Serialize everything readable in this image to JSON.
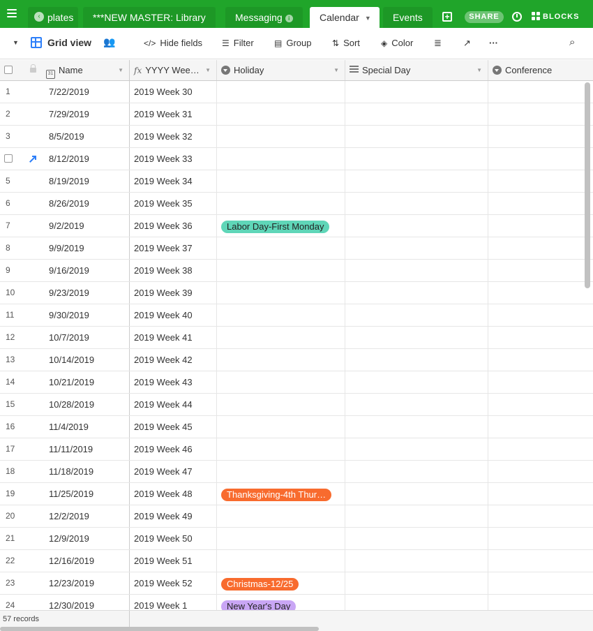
{
  "tabs": [
    {
      "label": "plates"
    },
    {
      "label": "***NEW MASTER: Library"
    },
    {
      "label": "Messaging"
    },
    {
      "label": "Calendar"
    },
    {
      "label": "Events"
    }
  ],
  "share_label": "SHARE",
  "blocks_label": "BLOCKS",
  "toolbar": {
    "view_name": "Grid view",
    "hide_fields": "Hide fields",
    "filter": "Filter",
    "group": "Group",
    "sort": "Sort",
    "color": "Color"
  },
  "columns": {
    "name": "Name",
    "week": "YYYY Wee…",
    "holiday": "Holiday",
    "special_day": "Special Day",
    "conference": "Conference"
  },
  "rows": [
    {
      "num": "1",
      "name": "7/22/2019",
      "week": "2019 Week 30",
      "holiday": ""
    },
    {
      "num": "2",
      "name": "7/29/2019",
      "week": "2019 Week 31",
      "holiday": ""
    },
    {
      "num": "3",
      "name": "8/5/2019",
      "week": "2019 Week 32",
      "holiday": ""
    },
    {
      "num": "",
      "name": "8/12/2019",
      "week": "2019 Week 33",
      "holiday": ""
    },
    {
      "num": "5",
      "name": "8/19/2019",
      "week": "2019 Week 34",
      "holiday": ""
    },
    {
      "num": "6",
      "name": "8/26/2019",
      "week": "2019 Week 35",
      "holiday": ""
    },
    {
      "num": "7",
      "name": "9/2/2019",
      "week": "2019 Week 36",
      "holiday": "Labor Day-First Monday",
      "holiday_color": "teal"
    },
    {
      "num": "8",
      "name": "9/9/2019",
      "week": "2019 Week 37",
      "holiday": ""
    },
    {
      "num": "9",
      "name": "9/16/2019",
      "week": "2019 Week 38",
      "holiday": ""
    },
    {
      "num": "10",
      "name": "9/23/2019",
      "week": "2019 Week 39",
      "holiday": ""
    },
    {
      "num": "11",
      "name": "9/30/2019",
      "week": "2019 Week 40",
      "holiday": ""
    },
    {
      "num": "12",
      "name": "10/7/2019",
      "week": "2019 Week 41",
      "holiday": ""
    },
    {
      "num": "13",
      "name": "10/14/2019",
      "week": "2019 Week 42",
      "holiday": ""
    },
    {
      "num": "14",
      "name": "10/21/2019",
      "week": "2019 Week 43",
      "holiday": ""
    },
    {
      "num": "15",
      "name": "10/28/2019",
      "week": "2019 Week 44",
      "holiday": ""
    },
    {
      "num": "16",
      "name": "11/4/2019",
      "week": "2019 Week 45",
      "holiday": ""
    },
    {
      "num": "17",
      "name": "11/11/2019",
      "week": "2019 Week 46",
      "holiday": ""
    },
    {
      "num": "18",
      "name": "11/18/2019",
      "week": "2019 Week 47",
      "holiday": ""
    },
    {
      "num": "19",
      "name": "11/25/2019",
      "week": "2019 Week 48",
      "holiday": "Thanksgiving-4th Thur…",
      "holiday_color": "orange"
    },
    {
      "num": "20",
      "name": "12/2/2019",
      "week": "2019 Week 49",
      "holiday": ""
    },
    {
      "num": "21",
      "name": "12/9/2019",
      "week": "2019 Week 50",
      "holiday": ""
    },
    {
      "num": "22",
      "name": "12/16/2019",
      "week": "2019 Week 51",
      "holiday": ""
    },
    {
      "num": "23",
      "name": "12/23/2019",
      "week": "2019 Week 52",
      "holiday": "Christmas-12/25",
      "holiday_color": "orange"
    },
    {
      "num": "24",
      "name": "12/30/2019",
      "week": "2019 Week 1",
      "holiday": "New Year's Day",
      "holiday_color": "purple"
    }
  ],
  "footer": {
    "record_count": "57 records"
  },
  "colors": {
    "brand_green": "#20a52a",
    "accent_blue": "#2d7ff9",
    "pill_teal": "#5fd6b8",
    "pill_orange": "#f86b2e",
    "pill_purple": "#c9a6f5"
  }
}
